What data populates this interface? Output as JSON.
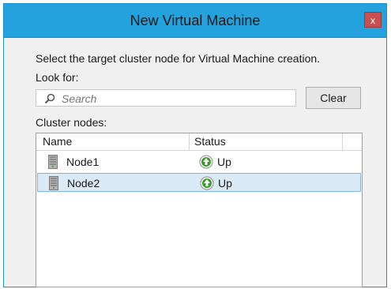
{
  "window": {
    "title": "New Virtual Machine",
    "close_label": "x"
  },
  "instruction": "Select the target cluster node for Virtual Machine creation.",
  "look_for_label": "Look for:",
  "search": {
    "placeholder": "Search",
    "value": ""
  },
  "clear_button": "Clear",
  "cluster_nodes_label": "Cluster nodes:",
  "columns": {
    "name": "Name",
    "status": "Status"
  },
  "nodes": [
    {
      "name": "Node1",
      "status": "Up",
      "selected": false
    },
    {
      "name": "Node2",
      "status": "Up",
      "selected": true
    }
  ],
  "icons": {
    "node": "server-icon",
    "status": "green-up-arrow-icon",
    "search": "search-icon"
  },
  "colors": {
    "titlebar": "#23a2dd",
    "close_button": "#c75050",
    "selection": "#dbeaf7",
    "status_up": "#3a9a2a"
  }
}
